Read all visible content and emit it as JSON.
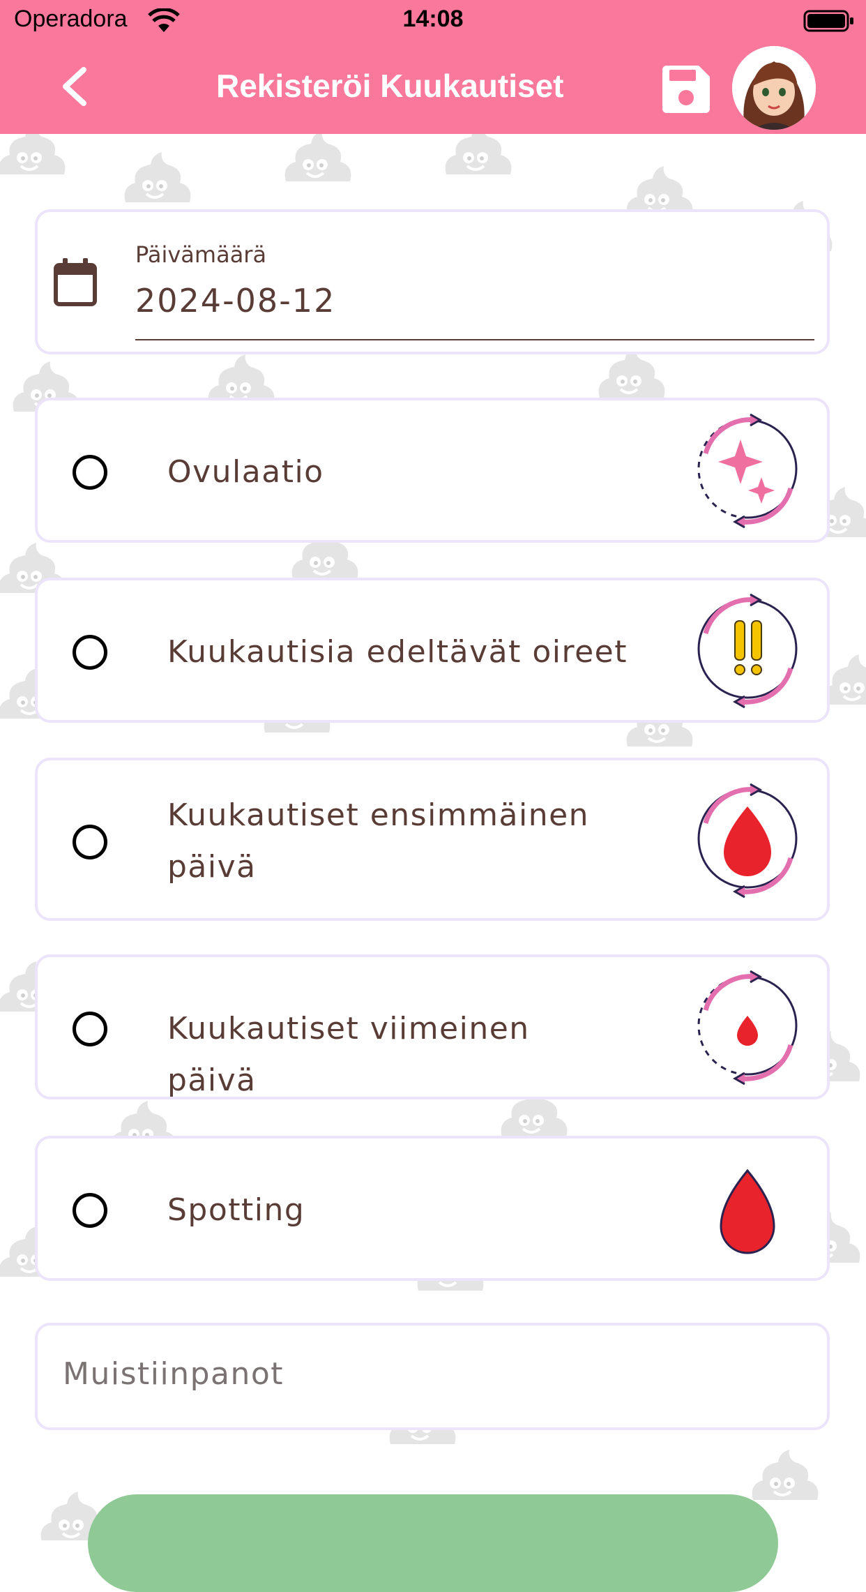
{
  "status_bar": {
    "carrier": "Operadora",
    "time": "14:08"
  },
  "app_bar": {
    "title": "Rekisteröi Kuukautiset"
  },
  "date_field": {
    "label": "Päivämäärä",
    "value": "2024-08-12"
  },
  "options": [
    {
      "label": "Ovulaatio",
      "icon": "ovulation-sparkle-cycle-icon",
      "selected": false
    },
    {
      "label": "Kuukautisia edeltävät oireet",
      "icon": "pms-exclamation-cycle-icon",
      "selected": false
    },
    {
      "label": "Kuukautiset ensimmäinen päivä",
      "icon": "period-first-day-drop-cycle-icon",
      "selected": false
    },
    {
      "label": "Kuukautiset viimeinen päivä",
      "icon": "period-last-day-small-drop-cycle-icon",
      "selected": false
    },
    {
      "label": "Spotting",
      "icon": "blood-drop-icon",
      "selected": false
    }
  ],
  "notes": {
    "placeholder": "Muistiinpanot",
    "value": ""
  },
  "colors": {
    "app_bar": "#f9789b",
    "text": "#5a3c37",
    "card_border": "#ece4fb",
    "submit": "#8fc995",
    "drop": "#e8232b",
    "accent_pink": "#e36fae"
  }
}
